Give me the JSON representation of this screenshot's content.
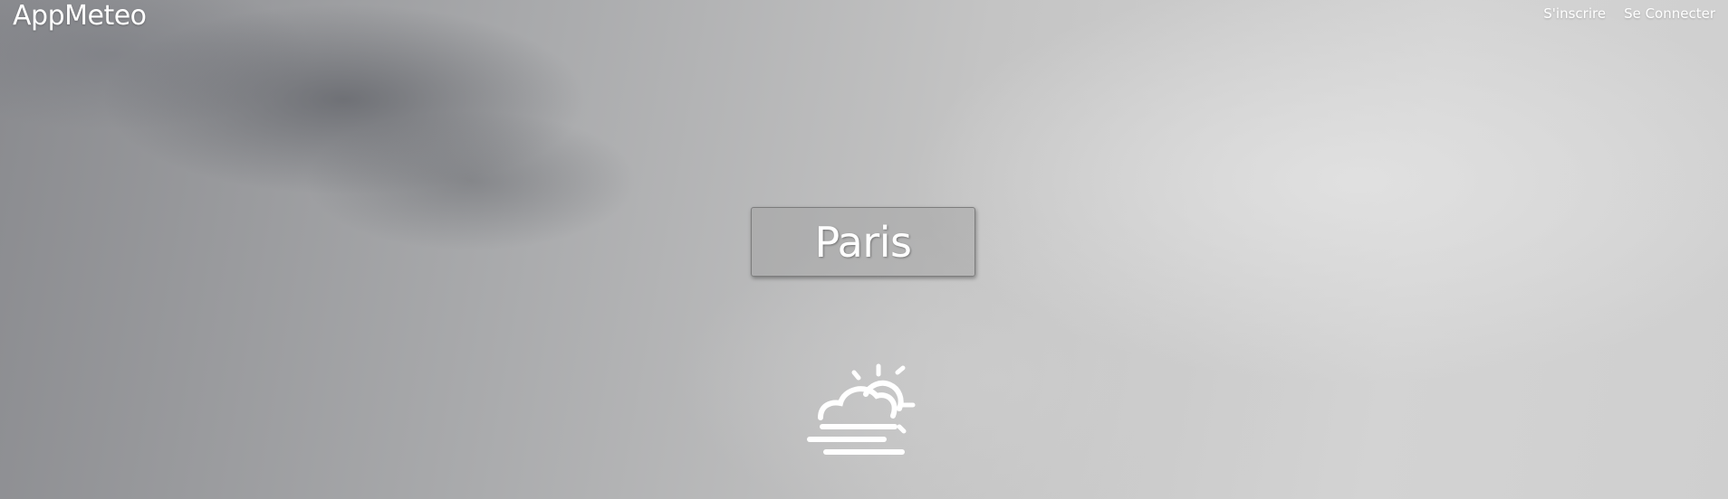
{
  "header": {
    "brand": "AppMeteo",
    "nav": {
      "signup": "S'inscrire",
      "login": "Se Connecter"
    }
  },
  "main": {
    "city": "Paris",
    "weather_icon": "sun-behind-cloud-fog-icon"
  },
  "colors": {
    "text": "#ffffff",
    "overlay_box": "#a0a0a0"
  }
}
